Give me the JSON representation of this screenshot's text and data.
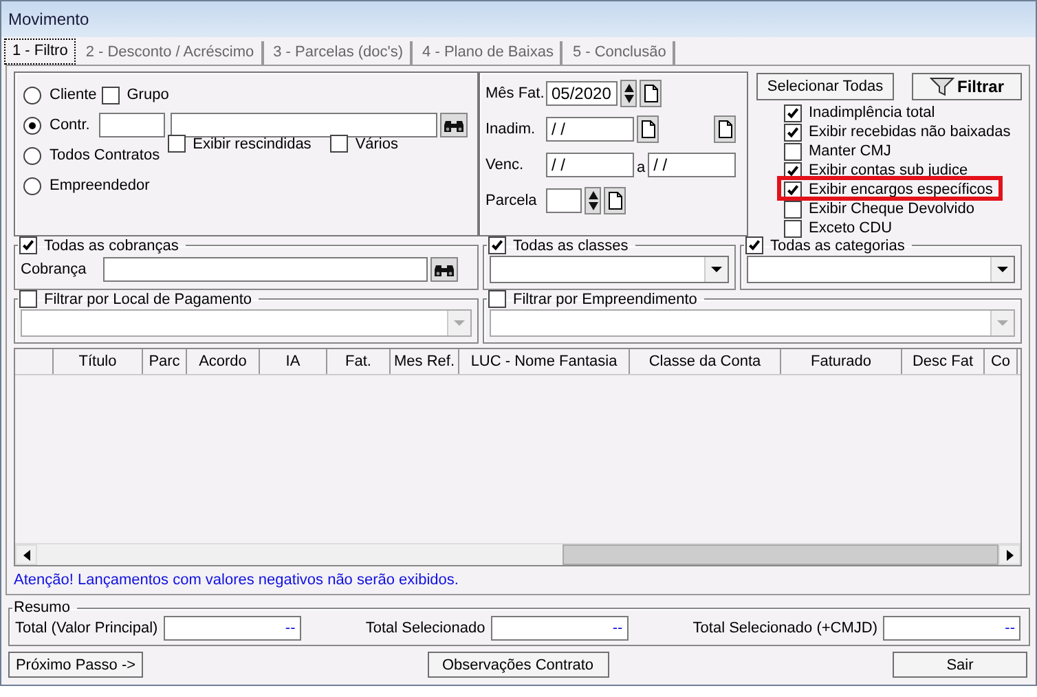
{
  "window": {
    "title": "Movimento"
  },
  "tabs": [
    {
      "label": "1 - Filtro",
      "selected": true
    },
    {
      "label": "2 - Desconto / Acréscimo",
      "selected": false
    },
    {
      "label": "3 - Parcelas (doc's)",
      "selected": false
    },
    {
      "label": "4 - Plano de Baixas",
      "selected": false
    },
    {
      "label": "5 - Conclusão",
      "selected": false
    }
  ],
  "selection": {
    "options": [
      {
        "label": "Cliente",
        "selected": false
      },
      {
        "label": "Contr.",
        "selected": true
      },
      {
        "label": "Todos Contratos",
        "selected": false
      },
      {
        "label": "Empreendedor",
        "selected": false
      }
    ],
    "grupo": {
      "label": "Grupo",
      "checked": false
    },
    "exibir_rescindidas": {
      "label": "Exibir rescindidas",
      "checked": false
    },
    "varios": {
      "label": "Vários",
      "checked": false
    }
  },
  "dates": {
    "mes_fat": {
      "label": "Mês Fat.",
      "value": "05/2020"
    },
    "inadim": {
      "label": "Inadim.",
      "value": "/ /"
    },
    "venc": {
      "label": "Venc.",
      "from": "/ /",
      "separator": "a",
      "to": "/ /"
    },
    "parcela": {
      "label": "Parcela"
    }
  },
  "actions": {
    "select_all": "Selecionar Todas",
    "filter": "Filtrar"
  },
  "options": [
    {
      "label": "Inadimplência total",
      "checked": true,
      "highlighted": false
    },
    {
      "label": "Exibir recebidas não baixadas",
      "checked": true,
      "highlighted": false
    },
    {
      "label": "Manter CMJ",
      "checked": false,
      "highlighted": false
    },
    {
      "label": "Exibir contas sub judice",
      "checked": true,
      "highlighted": false
    },
    {
      "label": "Exibir encargos específicos",
      "checked": true,
      "highlighted": true
    },
    {
      "label": "Exibir Cheque Devolvido",
      "checked": false,
      "highlighted": false
    },
    {
      "label": "Exceto CDU",
      "checked": false,
      "highlighted": false
    }
  ],
  "filters": {
    "cobrancas": {
      "label": "Todas as cobranças",
      "checked": true,
      "field_label": "Cobrança"
    },
    "classes": {
      "label": "Todas as classes",
      "checked": true
    },
    "categorias": {
      "label": "Todas as categorias",
      "checked": true
    },
    "local_pagamento": {
      "label": "Filtrar por Local de Pagamento",
      "checked": false
    },
    "empreendimento": {
      "label": "Filtrar por Empreendimento",
      "checked": false
    }
  },
  "table": {
    "columns": [
      "Título",
      "Parc",
      "Acordo",
      "IA",
      "Fat.",
      "Mes Ref.",
      "LUC - Nome Fantasia",
      "Classe da Conta",
      "Faturado",
      "Desc Fat",
      "Co"
    ]
  },
  "warning": "Atenção! Lançamentos com valores negativos não serão exibidos.",
  "summary": {
    "title": "Resumo",
    "fields": [
      {
        "label": "Total (Valor Principal)",
        "value": "--"
      },
      {
        "label": "Total Selecionado",
        "value": "--"
      },
      {
        "label": "Total Selecionado (+CMJD)",
        "value": "--"
      }
    ]
  },
  "buttons": [
    "Próximo Passo ->",
    "Observações Contrato",
    "Sair"
  ]
}
